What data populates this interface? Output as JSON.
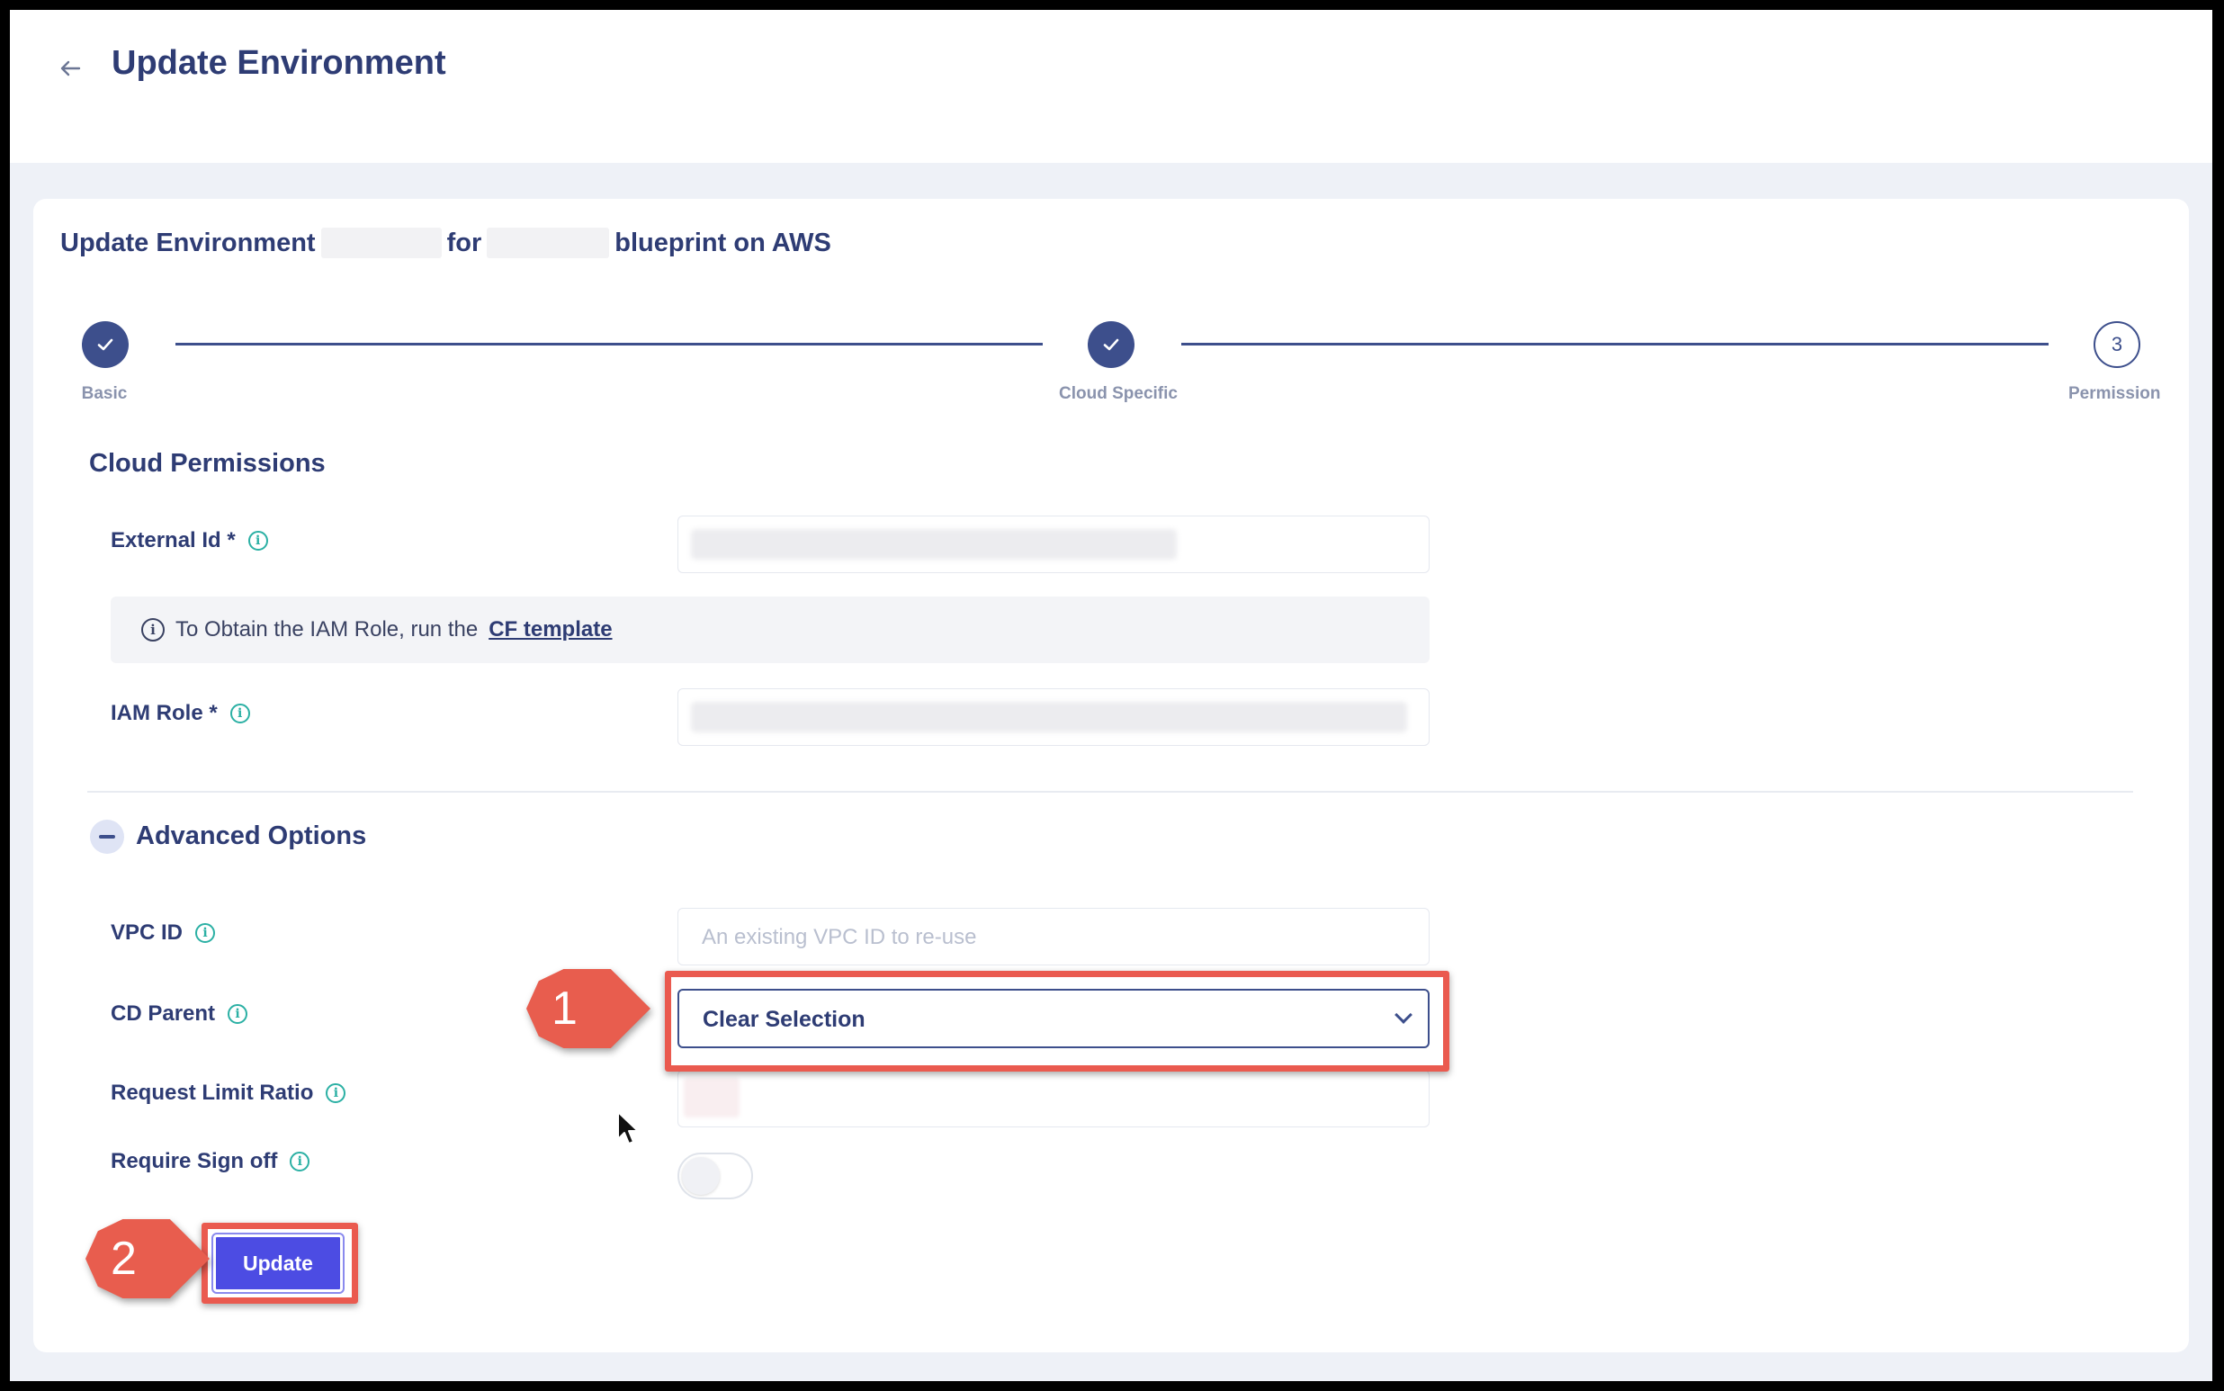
{
  "header": {
    "back_icon": "arrow-left-icon",
    "title": "Update Environment"
  },
  "card": {
    "heading_prefix": "Update Environment",
    "heading_mid": "for",
    "heading_suffix": "blueprint on AWS"
  },
  "stepper": {
    "steps": [
      {
        "label": "Basic",
        "state": "done"
      },
      {
        "label": "Cloud Specific",
        "state": "done"
      },
      {
        "label": "Permission",
        "state": "current",
        "number": "3"
      }
    ]
  },
  "cloud_permissions": {
    "title": "Cloud Permissions",
    "external_id_label": "External Id *",
    "callout_text": "To Obtain the IAM Role, run the",
    "callout_link": "CF template",
    "iam_role_label": "IAM Role *"
  },
  "advanced": {
    "title": "Advanced Options",
    "vpc_label": "VPC ID",
    "vpc_placeholder": "An existing VPC ID to re-use",
    "cd_parent_label": "CD Parent",
    "cd_parent_value": "Clear Selection",
    "request_limit_label": "Request Limit Ratio",
    "require_signoff_label": "Require Sign off",
    "require_signoff_enabled": false
  },
  "actions": {
    "update_label": "Update"
  },
  "annotations": {
    "badge_1": "1",
    "badge_2": "2",
    "highlight_color": "#ea5a4f"
  },
  "colors": {
    "primary": "#2e3c74",
    "accent": "#4c4ce3",
    "info": "#2bb0a4"
  }
}
